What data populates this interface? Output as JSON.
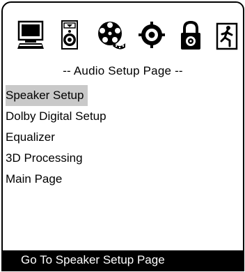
{
  "icons": [
    {
      "name": "general-setup-icon",
      "label": ""
    },
    {
      "name": "speaker-icon",
      "label": ""
    },
    {
      "name": "film-reel-icon",
      "label": ""
    },
    {
      "name": "preferences-target-icon",
      "label": ""
    },
    {
      "name": "lock-icon",
      "label": ""
    },
    {
      "name": "exit-icon",
      "label": ""
    }
  ],
  "page_title": "-- Audio Setup Page --",
  "menu": {
    "items": [
      {
        "label": "Speaker Setup",
        "selected": true
      },
      {
        "label": "Dolby Digital Setup",
        "selected": false
      },
      {
        "label": "Equalizer",
        "selected": false
      },
      {
        "label": "3D Processing",
        "selected": false
      },
      {
        "label": "Main Page",
        "selected": false
      }
    ]
  },
  "status": {
    "text": "Go To Speaker Setup Page"
  },
  "colors": {
    "background": "#ffffff",
    "foreground": "#000000",
    "highlight": "#c9c9c9",
    "status_bar": "#000000",
    "status_text": "#ffffff"
  }
}
